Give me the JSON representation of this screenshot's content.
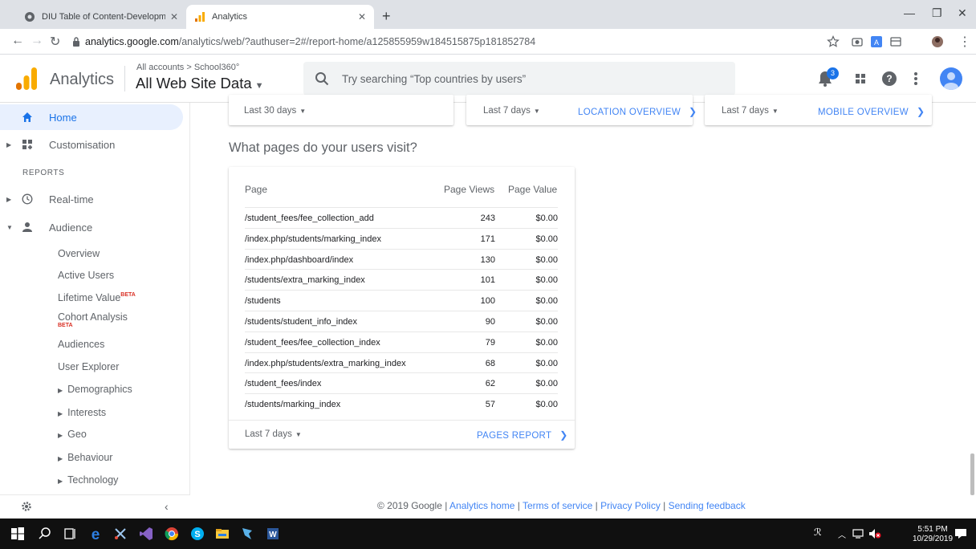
{
  "browser": {
    "tabs": [
      {
        "title": "DIU Table of Content-Developme",
        "active": false
      },
      {
        "title": "Analytics",
        "active": true
      }
    ],
    "url_host": "analytics.google.com",
    "url_rest": "/analytics/web/?authuser=2#/report-home/a125855959w184515875p181852784"
  },
  "header": {
    "brand": "Analytics",
    "account_path": "All accounts > School360°",
    "account_view": "All Web Site Data",
    "search_placeholder": "Try searching “Top countries by users”",
    "notification_count": "3"
  },
  "sidebar": {
    "home": "Home",
    "customisation": "Customisation",
    "reports_header": "REPORTS",
    "realtime": "Real-time",
    "audience": "Audience",
    "sub_items": [
      "Overview",
      "Active Users",
      "Lifetime Value",
      "Cohort Analysis",
      "Audiences",
      "User Explorer",
      "Demographics",
      "Interests",
      "Geo",
      "Behaviour",
      "Technology"
    ],
    "beta": "BETA"
  },
  "top_cards": {
    "card1_date": "Last 30 days",
    "card2_date": "Last 7 days",
    "card2_link": "LOCATION OVERVIEW",
    "card3_date": "Last 7 days",
    "card3_link": "MOBILE OVERVIEW"
  },
  "section_title": "What pages do your users visit?",
  "pages_table": {
    "columns": [
      "Page",
      "Page Views",
      "Page Value"
    ],
    "rows": [
      {
        "page": "/student_fees/fee_collection_add",
        "views": "243",
        "value": "$0.00"
      },
      {
        "page": "/index.php/students/marking_index",
        "views": "171",
        "value": "$0.00"
      },
      {
        "page": "/index.php/dashboard/index",
        "views": "130",
        "value": "$0.00"
      },
      {
        "page": "/students/extra_marking_index",
        "views": "101",
        "value": "$0.00"
      },
      {
        "page": "/students",
        "views": "100",
        "value": "$0.00"
      },
      {
        "page": "/students/student_info_index",
        "views": "90",
        "value": "$0.00"
      },
      {
        "page": "/student_fees/fee_collection_index",
        "views": "79",
        "value": "$0.00"
      },
      {
        "page": "/index.php/students/extra_marking_index",
        "views": "68",
        "value": "$0.00"
      },
      {
        "page": "/student_fees/index",
        "views": "62",
        "value": "$0.00"
      },
      {
        "page": "/students/marking_index",
        "views": "57",
        "value": "$0.00"
      }
    ],
    "footer_date": "Last 7 days",
    "footer_link": "PAGES REPORT"
  },
  "footer": {
    "copyright": "© 2019 Google | ",
    "links": [
      "Analytics home",
      "Terms of service",
      "Privacy Policy",
      "Sending feedback"
    ],
    "separator": " | "
  },
  "taskbar": {
    "time": "5:51 PM",
    "date": "10/29/2019"
  },
  "colors": {
    "accent": "#1a73e8",
    "link": "#4285f4",
    "ga_orange": "#f9ab00",
    "ga_dark_orange": "#e37400"
  }
}
